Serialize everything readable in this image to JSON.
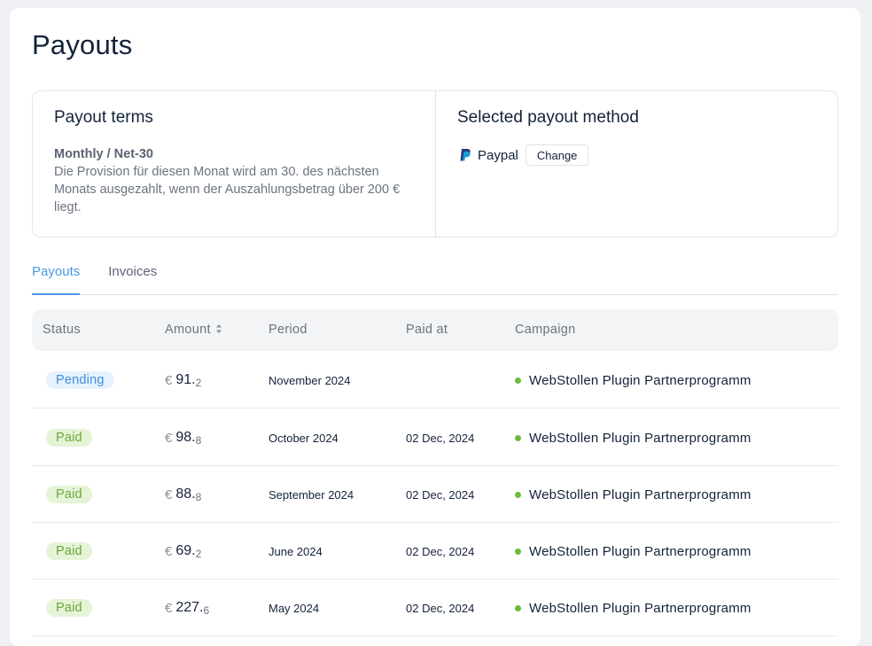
{
  "page": {
    "title": "Payouts"
  },
  "terms": {
    "heading": "Payout terms",
    "label": "Monthly / Net-30",
    "description": "Die Provision für diesen Monat wird am 30. des nächsten Monats ausgezahlt, wenn der Auszahlungsbetrag über 200 € liegt."
  },
  "method": {
    "heading": "Selected payout method",
    "icon": "paypal-icon",
    "name": "Paypal",
    "change_label": "Change"
  },
  "tabs": [
    {
      "label": "Payouts",
      "active": true
    },
    {
      "label": "Invoices",
      "active": false
    }
  ],
  "table": {
    "columns": [
      "Status",
      "Amount",
      "Period",
      "Paid at",
      "Campaign"
    ],
    "currency": "€",
    "rows": [
      {
        "status": "Pending",
        "status_type": "pending",
        "amount_int": "91.",
        "amount_dec": "2",
        "period": "November 2024",
        "paid_at": "",
        "campaign": "WebStollen Plugin Partnerprogramm"
      },
      {
        "status": "Paid",
        "status_type": "paid",
        "amount_int": "98.",
        "amount_dec": "8",
        "period": "October 2024",
        "paid_at": "02 Dec, 2024",
        "campaign": "WebStollen Plugin Partnerprogramm"
      },
      {
        "status": "Paid",
        "status_type": "paid",
        "amount_int": "88.",
        "amount_dec": "8",
        "period": "September 2024",
        "paid_at": "02 Dec, 2024",
        "campaign": "WebStollen Plugin Partnerprogramm"
      },
      {
        "status": "Paid",
        "status_type": "paid",
        "amount_int": "69.",
        "amount_dec": "2",
        "period": "June 2024",
        "paid_at": "02 Dec, 2024",
        "campaign": "WebStollen Plugin Partnerprogramm"
      },
      {
        "status": "Paid",
        "status_type": "paid",
        "amount_int": "227.",
        "amount_dec": "6",
        "period": "May 2024",
        "paid_at": "02 Dec, 2024",
        "campaign": "WebStollen Plugin Partnerprogramm"
      }
    ]
  },
  "colors": {
    "accent": "#4a98e0",
    "paid": "#6aa83a",
    "pending": "#3f90dc",
    "campaign_dot": "#6cbb3c"
  }
}
